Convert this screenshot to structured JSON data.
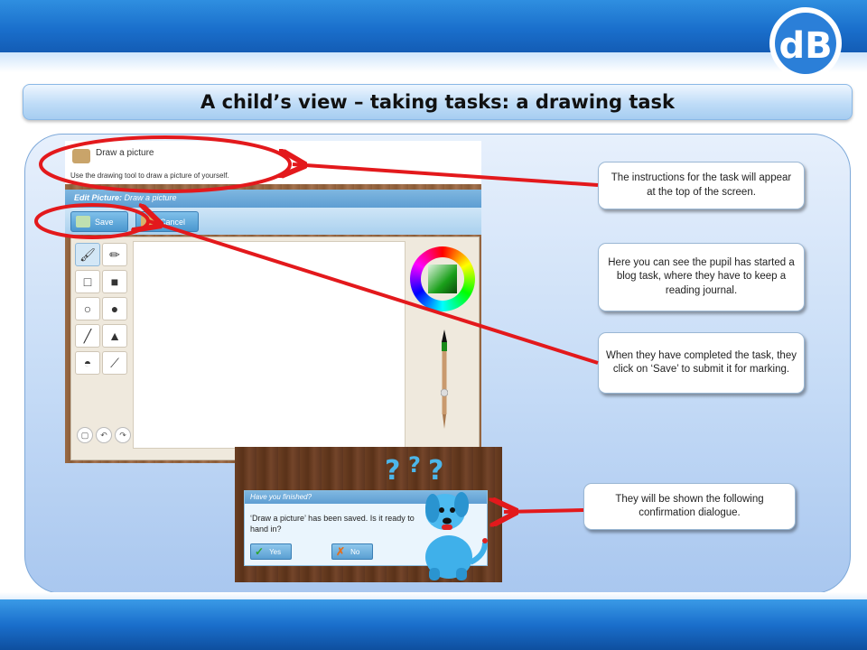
{
  "slide": {
    "title": "A child’s view – taking tasks: a drawing task",
    "logo_text": "dB"
  },
  "app": {
    "instructions_title": "Draw a picture",
    "instructions_text": "Use the drawing tool to draw a picture of yourself.",
    "edit_header_label": "Edit Picture:",
    "edit_header_value": "Draw a picture",
    "save_label": "Save",
    "cancel_label": "Cancel",
    "tools": [
      "brush-tool-icon",
      "pencil-tool-icon",
      "square-outline-tool-icon",
      "square-filled-tool-icon",
      "circle-outline-tool-icon",
      "circle-filled-tool-icon",
      "line-tool-icon",
      "spray-tool-icon",
      "fill-bucket-tool-icon",
      "eyedropper-tool-icon"
    ]
  },
  "dialog": {
    "header": "Have you finished?",
    "message": "‘Draw a picture’ has been saved. Is it ready to hand in?",
    "yes_label": "Yes",
    "no_label": "No"
  },
  "callouts": {
    "instructions": "The instructions for the task will appear at the top of the screen.",
    "blog": "Here you can see the pupil has started a blog task, where they have to keep a reading journal.",
    "save": "When they have completed the task, they click on ‘Save’ to submit it for marking.",
    "confirm": "They will be shown the following confirmation dialogue."
  },
  "colors": {
    "arrow": "#e3191c",
    "header_blue": "#1a6fcc",
    "panel": "#c5dbf6"
  }
}
